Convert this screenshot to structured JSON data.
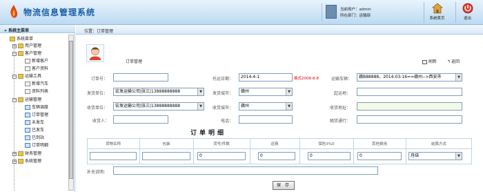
{
  "header": {
    "title": "物流信息管理系统",
    "user_line": "当前用户：admin",
    "dept_line": "所在部门：运输部",
    "home_label": "系统首页",
    "exit_label": "退出"
  },
  "sidebar": {
    "heading": "» 系统主菜单",
    "root": "系统菜单",
    "items": [
      {
        "label": "用户管理"
      },
      {
        "label": "客户管理"
      },
      {
        "label": "新增客户"
      },
      {
        "label": "客户资料"
      },
      {
        "label": "运输工具"
      },
      {
        "label": "新增汽车"
      },
      {
        "label": "资料列表"
      },
      {
        "label": "运输管理"
      },
      {
        "label": "车辆调度"
      },
      {
        "label": "订单管理"
      },
      {
        "label": "未发车"
      },
      {
        "label": "已发车"
      },
      {
        "label": "已到站"
      },
      {
        "label": "订单明细"
      },
      {
        "label": "财务管理"
      },
      {
        "label": "系统管理"
      }
    ]
  },
  "breadcrumb": "位置：订单管理",
  "page": {
    "title": "订单管理",
    "refresh": "刷新",
    "back": "返回"
  },
  "form": {
    "order_no_label": "订单号：",
    "order_no_value": "",
    "consign_date_label": "托运日期：",
    "consign_date_value": "2014-4-1",
    "date_hint": "格式2008-8-8",
    "vehicle_label": "运输车辆：",
    "vehicle_value": "赣B88888，2014-03-16==赣州-->西安市",
    "sender_unit_label": "发货单位：",
    "sender_unit_value": "宏发运输公司|张三|13888888888",
    "send_city_label": "发货城市：",
    "send_city_value": "赣州",
    "start_addr_label": "起运地：",
    "receiver_unit_label": "收货单位：",
    "receiver_unit_value": "宏发运输公司|张三|13888888888",
    "recv_city_label": "收货城市：",
    "recv_city_value": "赣州",
    "recv_addr_label": "收货地址：",
    "recipient_label": "收货人：",
    "phone_label": "电话：",
    "escort_label": "随货通行："
  },
  "detail": {
    "title": "订单明细",
    "columns": [
      "货物名称",
      "包装",
      "货号/件数",
      "运费",
      "保险3%0",
      "其他费用",
      "结算方式"
    ],
    "row": {
      "qty": "0",
      "freight": "0",
      "insurance": "0",
      "other": "0",
      "settle": "月结"
    },
    "remark_label": "补充说明：",
    "save_label": "保 存"
  }
}
